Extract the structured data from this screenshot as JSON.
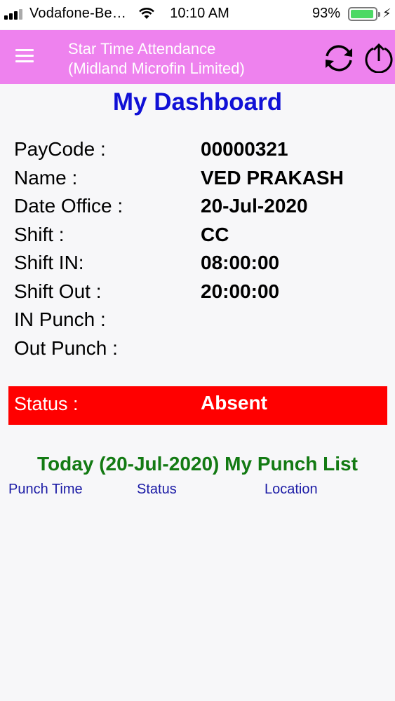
{
  "statusbar": {
    "carrier": "Vodafone-Be…",
    "time": "10:10 AM",
    "battery": "93%",
    "battery_level": 0.93,
    "icons": [
      "signal-icon",
      "wifi-icon",
      "battery-icon",
      "charging-bolt-icon"
    ]
  },
  "appbar": {
    "title_line1": "Star Time Attendance",
    "title_line2": "(Midland Microfin Limited)",
    "background": "#ee82ee",
    "icons": [
      "menu-icon",
      "refresh-icon",
      "upload-icon"
    ]
  },
  "dashboard": {
    "title": "My Dashboard",
    "title_color": "#1010d6",
    "fields": [
      {
        "label": "PayCode :",
        "value": "00000321"
      },
      {
        "label": "Name :",
        "value": "VED PRAKASH"
      },
      {
        "label": "Date Office :",
        "value": "20-Jul-2020"
      },
      {
        "label": "Shift :",
        "value": "CC"
      },
      {
        "label": "Shift IN:",
        "value": "08:00:00"
      },
      {
        "label": "Shift Out :",
        "value": "20:00:00"
      },
      {
        "label": "IN Punch :",
        "value": ""
      },
      {
        "label": "Out Punch :",
        "value": ""
      }
    ],
    "status": {
      "label": "Status :",
      "value": "Absent",
      "color": "#ff0000"
    }
  },
  "punch_list": {
    "title": "Today (20-Jul-2020) My Punch List",
    "title_color": "#137a13",
    "columns": [
      "Punch Time",
      "Status",
      "Location"
    ],
    "rows": []
  }
}
